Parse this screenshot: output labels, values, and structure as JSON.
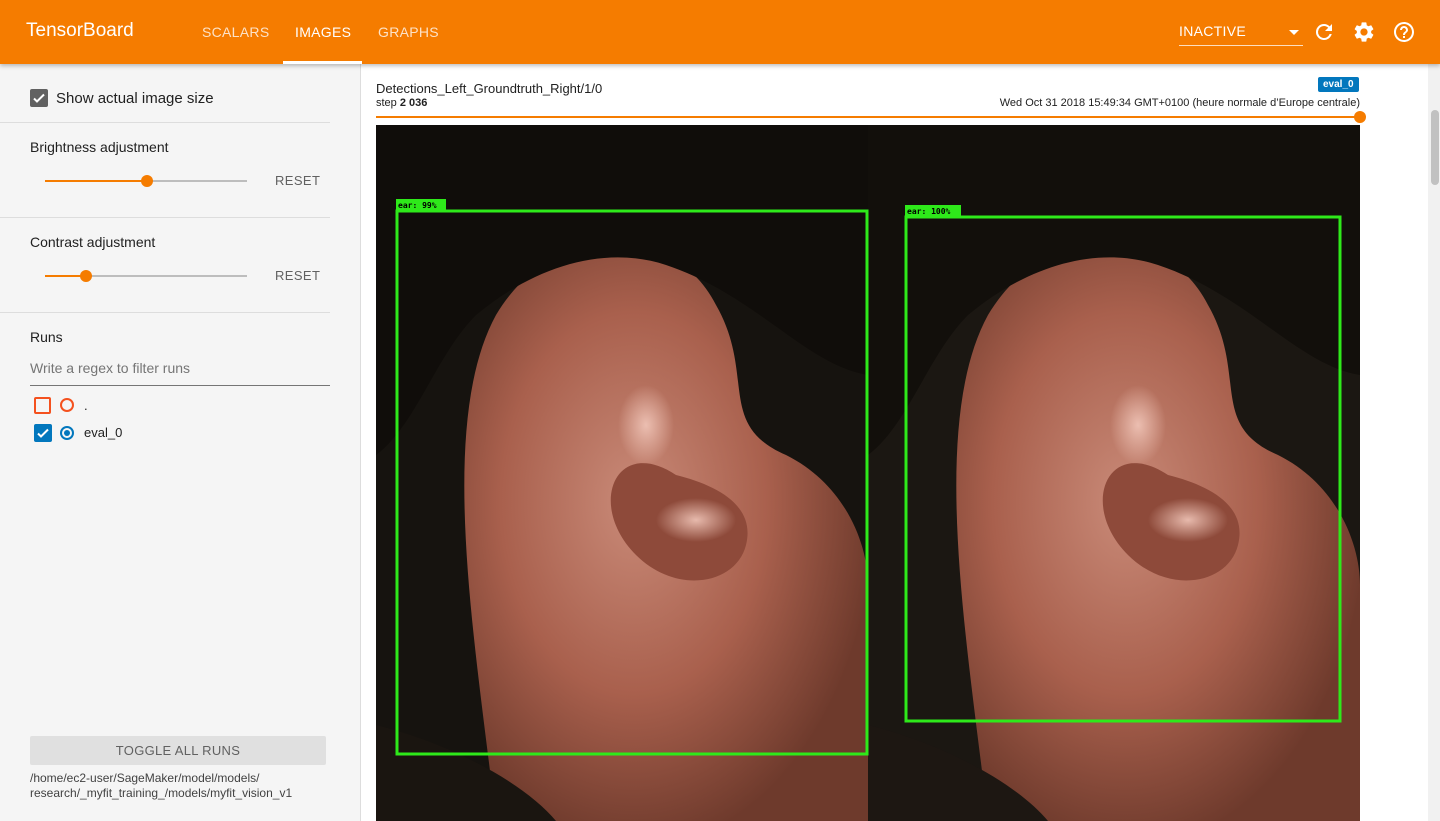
{
  "app": {
    "brand": "TensorBoard",
    "tabs": [
      {
        "label": "SCALARS"
      },
      {
        "label": "IMAGES"
      },
      {
        "label": "GRAPHS"
      }
    ],
    "run_status": "INACTIVE",
    "icons": [
      "refresh-icon",
      "settings-gear-icon",
      "help-circle-icon"
    ],
    "accent_color": "#f57c00"
  },
  "sidebar": {
    "show_actual_size": {
      "label": "Show actual image size",
      "checked": true
    },
    "brightness": {
      "label": "Brightness adjustment",
      "value": 0.5,
      "reset": "RESET"
    },
    "contrast": {
      "label": "Contrast adjustment",
      "value": 0.2,
      "reset": "RESET"
    },
    "runs": {
      "title": "Runs",
      "filter_placeholder": "Write a regex to filter runs",
      "items": [
        {
          "name": ".",
          "checked": false,
          "color": "#f4511e"
        },
        {
          "name": "eval_0",
          "checked": true,
          "color": "#0277bd"
        }
      ]
    },
    "toggle_all": "TOGGLE ALL RUNS",
    "logdir_line1": "/home/ec2-user/SageMaker/model/models/",
    "logdir_line2": "research/_myfit_training_/models/myfit_vision_v1"
  },
  "card": {
    "tag": "Detections_Left_Groundtruth_Right/1/0",
    "run_badge": "eval_0",
    "step_label": "step",
    "step_value": "2 036",
    "timestamp": "Wed Oct 31 2018 15:49:34 GMT+0100 (heure normale d’Europe centrale)",
    "step_position": 1.0,
    "detections": [
      {
        "label": "ear: 99%"
      },
      {
        "label": "ear: 100%"
      }
    ]
  }
}
